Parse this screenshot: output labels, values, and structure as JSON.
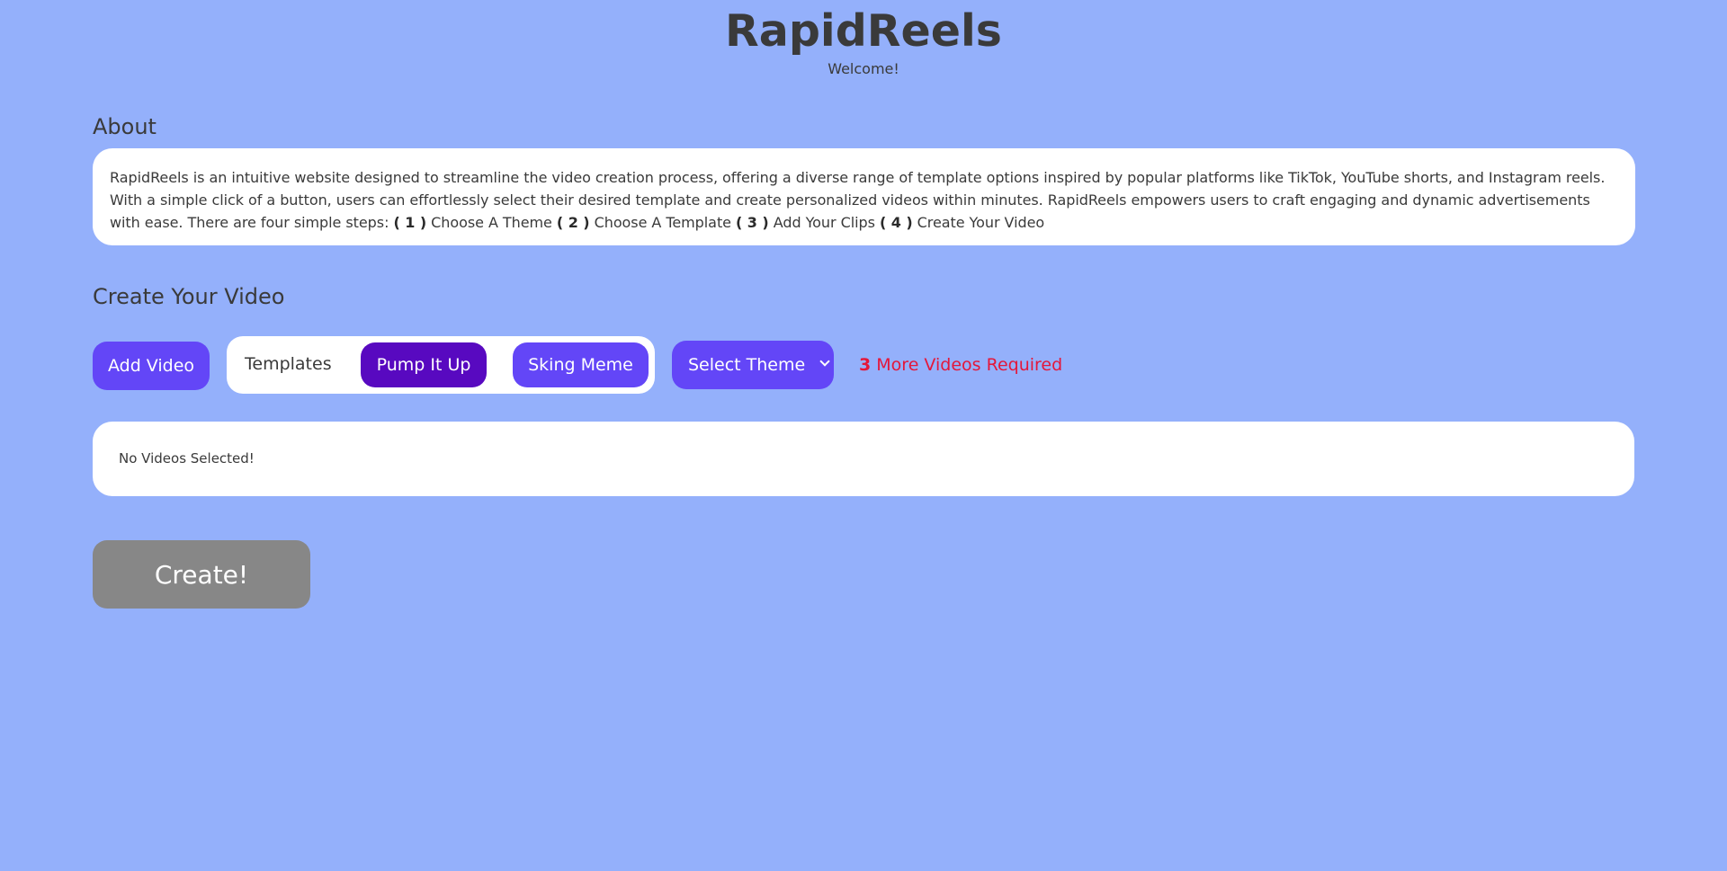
{
  "header": {
    "title": "RapidReels",
    "subtitle": "Welcome!"
  },
  "about": {
    "heading": "About",
    "intro": "RapidReels is an intuitive website designed to streamline the video creation process, offering a diverse range of template options inspired by popular platforms like TikTok, YouTube shorts, and Instagram reels. With a simple click of a button, users can effortlessly select their desired template and create personalized videos within minutes. RapidReels empowers users to craft engaging and dynamic advertisements with ease. There are four simple steps: ",
    "steps": [
      {
        "num": "( 1 )",
        "text": "Choose A Theme"
      },
      {
        "num": "( 2 )",
        "text": "Choose A Template"
      },
      {
        "num": "( 3 )",
        "text": "Add Your Clips"
      },
      {
        "num": "( 4 )",
        "text": "Create Your Video"
      }
    ]
  },
  "create": {
    "heading": "Create Your Video",
    "add_video_label": "Add Video",
    "templates_label": "Templates",
    "templates": [
      {
        "label": "Pump It Up",
        "selected": true
      },
      {
        "label": "Sking Meme",
        "selected": false
      }
    ],
    "theme_select": {
      "selected": "Select Theme"
    },
    "required_count": "3",
    "required_text": "More Videos Required",
    "videos_empty": "No Videos Selected!",
    "create_label": "Create!"
  },
  "colors": {
    "background": "#94b0fb",
    "primary_button": "#6346f7",
    "selected_template": "#5809c0",
    "warning_text": "#e4173a",
    "disabled_button": "#878787"
  }
}
